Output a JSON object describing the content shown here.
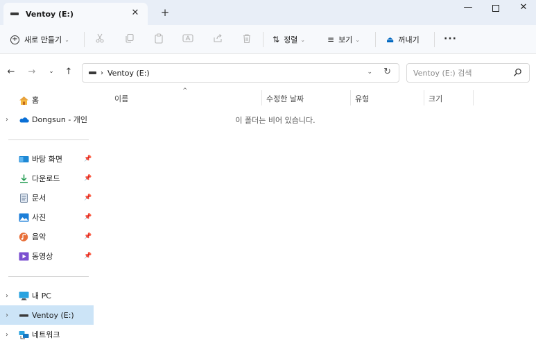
{
  "window": {
    "tab_title": "Ventoy (E:)",
    "tab_close": "✕",
    "new_tab": "+",
    "minimize": "—",
    "close": "✕"
  },
  "toolbar": {
    "new_label": "새로 만들기",
    "sort_label": "정렬",
    "view_label": "보기",
    "eject_label": "꺼내기",
    "more": "···"
  },
  "address": {
    "breadcrumb": "Ventoy (E:)",
    "search_placeholder": "Ventoy (E:) 검색"
  },
  "sidebar": {
    "home": "홈",
    "onedrive": "Dongsun - 개인",
    "quick_access": [
      {
        "label": "바탕 화면",
        "icon": "desktop-icon"
      },
      {
        "label": "다운로드",
        "icon": "download-icon"
      },
      {
        "label": "문서",
        "icon": "document-icon"
      },
      {
        "label": "사진",
        "icon": "picture-icon"
      },
      {
        "label": "음악",
        "icon": "music-icon"
      },
      {
        "label": "동영상",
        "icon": "video-icon"
      }
    ],
    "this_pc": "내 PC",
    "ventoy": "Ventoy (E:)",
    "network": "네트워크"
  },
  "columns": {
    "name": "이름",
    "modified": "수정한 날짜",
    "type": "유형",
    "size": "크기"
  },
  "empty_message": "이 폴더는 비어 있습니다.",
  "colors": {
    "accent": "#0067c0",
    "selected_bg": "#cce4f7",
    "title_bg": "#e8eef7"
  }
}
